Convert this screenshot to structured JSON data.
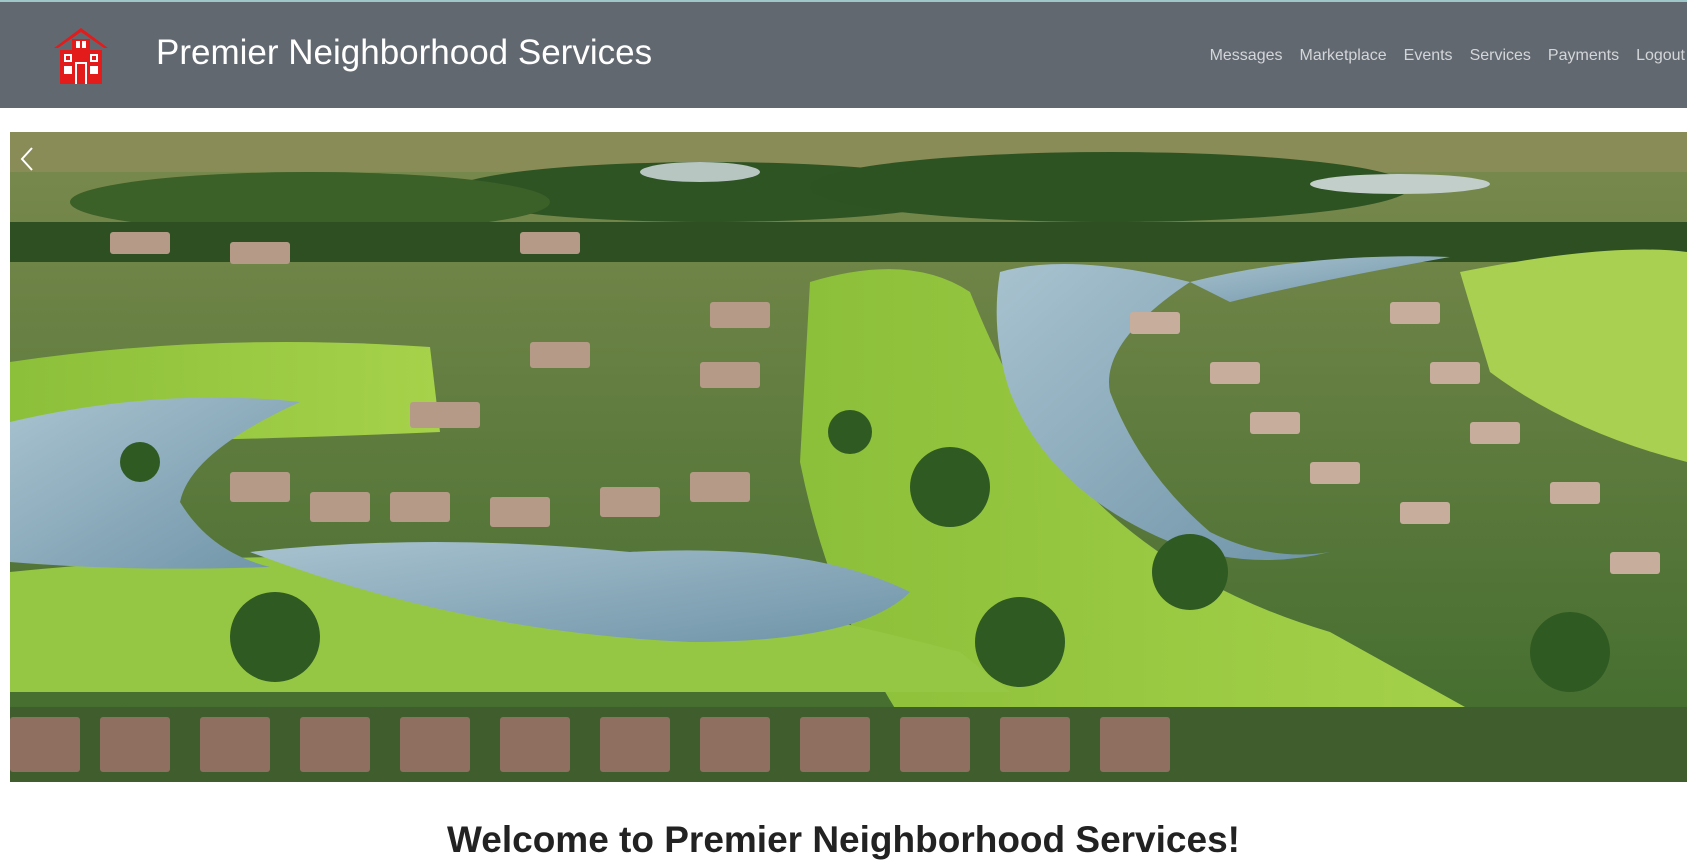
{
  "header": {
    "brand": "Premier Neighborhood Services",
    "logo_icon": "house-icon",
    "logo_color": "#e31b1b",
    "background": "#626870",
    "nav": [
      {
        "label": "Messages"
      },
      {
        "label": "Marketplace"
      },
      {
        "label": "Events"
      },
      {
        "label": "Services"
      },
      {
        "label": "Payments"
      },
      {
        "label": "Logout"
      }
    ]
  },
  "carousel": {
    "image_subject": "aerial view of golf course community",
    "prev_icon": "chevron-left-icon"
  },
  "main": {
    "welcome": "Welcome to Premier Neighborhood Services!"
  }
}
